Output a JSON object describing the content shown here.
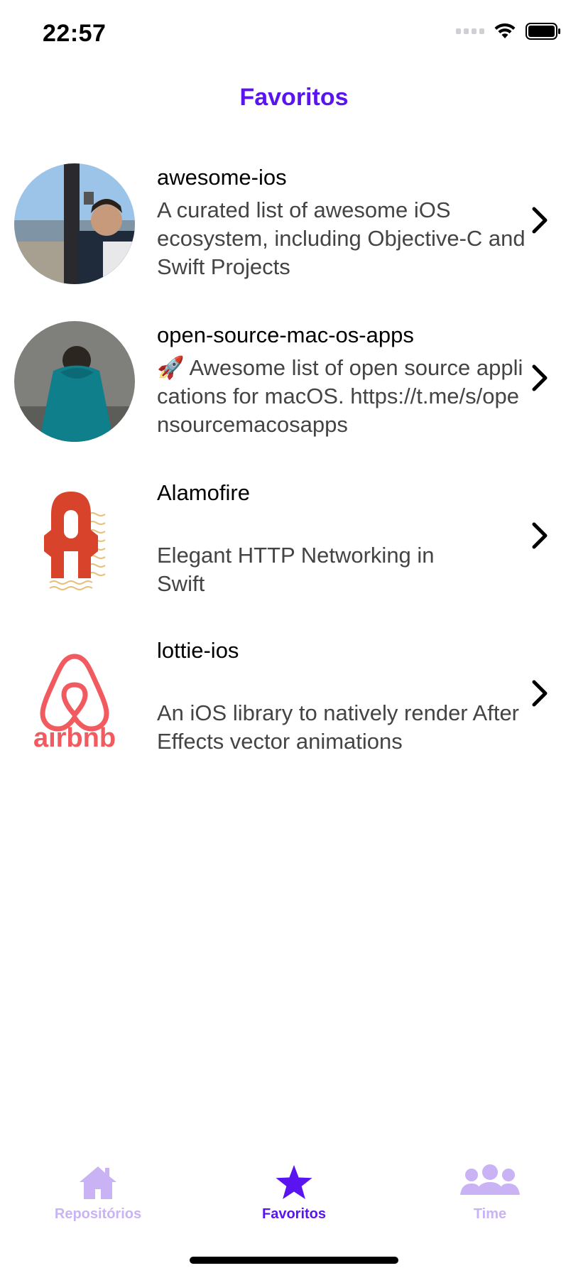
{
  "status_bar": {
    "time": "22:57"
  },
  "nav": {
    "title": "Favoritos"
  },
  "colors": {
    "accent": "#5A14F0",
    "accent_inactive": "#C9B3F5",
    "text_secondary": "#444444"
  },
  "repos": [
    {
      "name": "awesome-ios",
      "description": "A curated list of awesome iOS ecosystem, including Objective-C and Swift Projects",
      "avatar": "person-cable-car-avatar"
    },
    {
      "name": "open-source-mac-os-apps",
      "description": "🚀 Awesome list of open source applications for macOS. https://t.me/s/opensourcemacosapps",
      "avatar": "person-back-hoodie-avatar"
    },
    {
      "name": "Alamofire",
      "description": "Elegant HTTP Networking in Swift",
      "avatar": "alamofire-logo"
    },
    {
      "name": "lottie-ios",
      "description": "An iOS library to natively render After Effects vector animations",
      "avatar": "airbnb-logo",
      "logo_text": "airbnb"
    }
  ],
  "tabs": [
    {
      "label": "Repositórios",
      "icon": "house-icon",
      "active": false
    },
    {
      "label": "Favoritos",
      "icon": "star-icon",
      "active": true
    },
    {
      "label": "Time",
      "icon": "people-icon",
      "active": false
    }
  ]
}
